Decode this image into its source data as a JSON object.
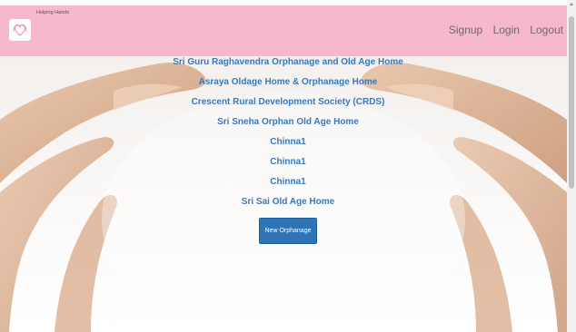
{
  "brand": {
    "name": "Helping Hands",
    "logo_icon": "heart-hands-icon"
  },
  "nav": {
    "items": [
      {
        "label": "Signup"
      },
      {
        "label": "Login"
      },
      {
        "label": "Logout"
      }
    ]
  },
  "orphanages": [
    {
      "name": "Sri Guru Raghavendra Orphanage and Old Age Home"
    },
    {
      "name": "Asraya Oldage Home & Orphanage Home"
    },
    {
      "name": "Crescent Rural Development Society (CRDS)"
    },
    {
      "name": "Sri Sneha Orphan Old Age Home"
    },
    {
      "name": "Chinna1"
    },
    {
      "name": "Chinna1"
    },
    {
      "name": "Chinna1"
    },
    {
      "name": "Sri Sai Old Age Home"
    }
  ],
  "actions": {
    "new_orphanage_label": "New Orphanage"
  },
  "colors": {
    "navbar_bg": "#f7b8cf",
    "link": "#3a78b8",
    "button_bg": "#2e74b6",
    "nav_text": "#6b6b6b"
  }
}
